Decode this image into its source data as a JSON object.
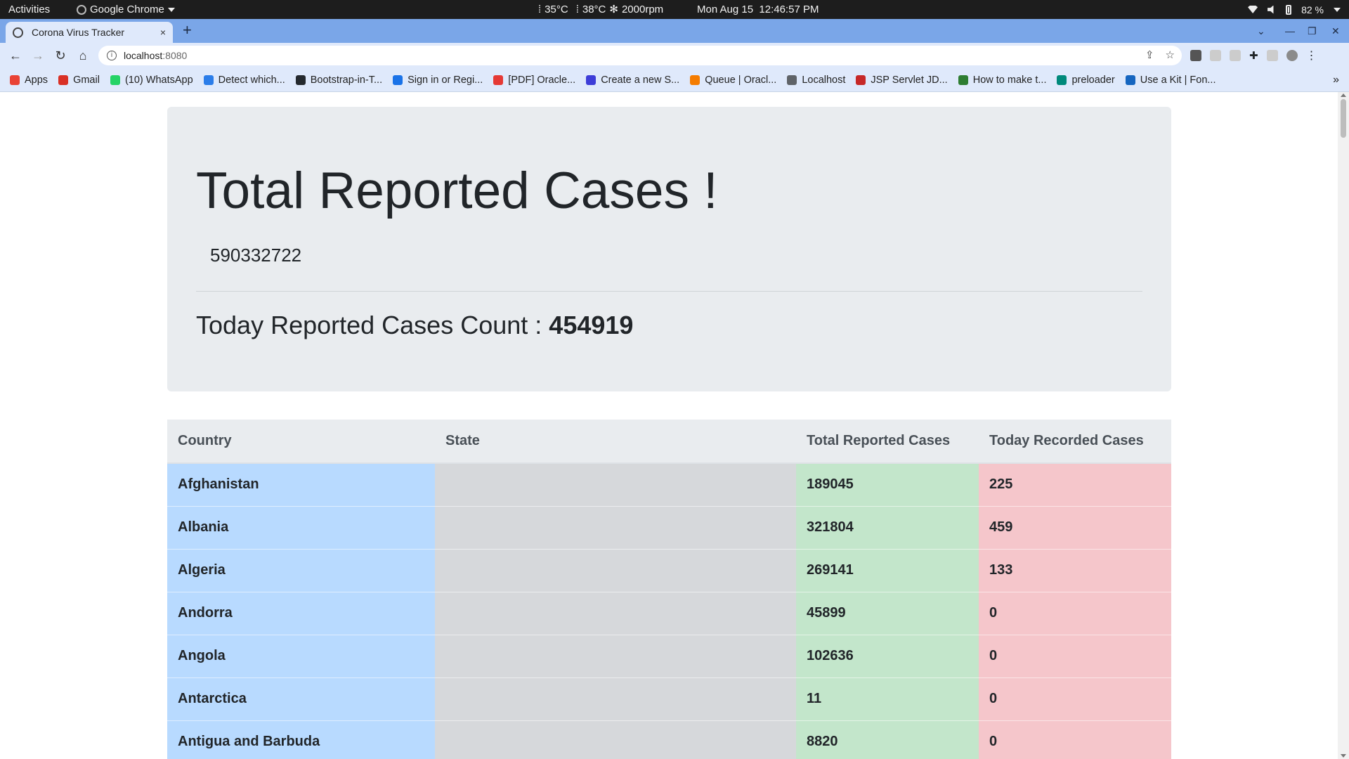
{
  "system_bar": {
    "activities": "Activities",
    "app_name": "Google Chrome",
    "temp1": "35°C",
    "temp2": "38°C",
    "fan": "2000rpm",
    "datetime": "Mon Aug 15  12:46:57 PM",
    "battery": "82 %"
  },
  "browser": {
    "tab_title": "Corona Virus Tracker",
    "tab_close": "×",
    "new_tab": "+",
    "url_host": "localhost",
    "url_port": ":8080",
    "bookmarks": [
      {
        "label": "Apps",
        "color": "#e94235"
      },
      {
        "label": "Gmail",
        "color": "#d93025"
      },
      {
        "label": "(10) WhatsApp",
        "color": "#25d366"
      },
      {
        "label": "Detect which...",
        "color": "#2b7de9"
      },
      {
        "label": "Bootstrap-in-T...",
        "color": "#24292e"
      },
      {
        "label": "Sign in or Regi...",
        "color": "#1a73e8"
      },
      {
        "label": "[PDF] Oracle...",
        "color": "#e53935"
      },
      {
        "label": "Create a new S...",
        "color": "#3d3dd8"
      },
      {
        "label": "Queue | Oracl...",
        "color": "#f57c00"
      },
      {
        "label": "Localhost",
        "color": "#5f6368"
      },
      {
        "label": "JSP Servlet JD...",
        "color": "#c62828"
      },
      {
        "label": "How to make t...",
        "color": "#2e7d32"
      },
      {
        "label": "preloader",
        "color": "#00897b"
      },
      {
        "label": "Use a Kit | Fon...",
        "color": "#1565c0"
      }
    ],
    "bookmarks_more": "»"
  },
  "page": {
    "heading": "Total Reported Cases !",
    "total_cases": "590332722",
    "today_label": "Today Reported Cases Count :",
    "today_count": "454919",
    "colors": {
      "country": "#b8daff",
      "state": "#d6d8db",
      "total": "#c3e6cb",
      "today": "#f5c6cb"
    },
    "table": {
      "headers": [
        "Country",
        "State",
        "Total Reported Cases",
        "Today Recorded Cases"
      ],
      "rows": [
        [
          "Afghanistan",
          "",
          "189045",
          "225"
        ],
        [
          "Albania",
          "",
          "321804",
          "459"
        ],
        [
          "Algeria",
          "",
          "269141",
          "133"
        ],
        [
          "Andorra",
          "",
          "45899",
          "0"
        ],
        [
          "Angola",
          "",
          "102636",
          "0"
        ],
        [
          "Antarctica",
          "",
          "11",
          "0"
        ],
        [
          "Antigua and Barbuda",
          "",
          "8820",
          "0"
        ]
      ]
    }
  }
}
